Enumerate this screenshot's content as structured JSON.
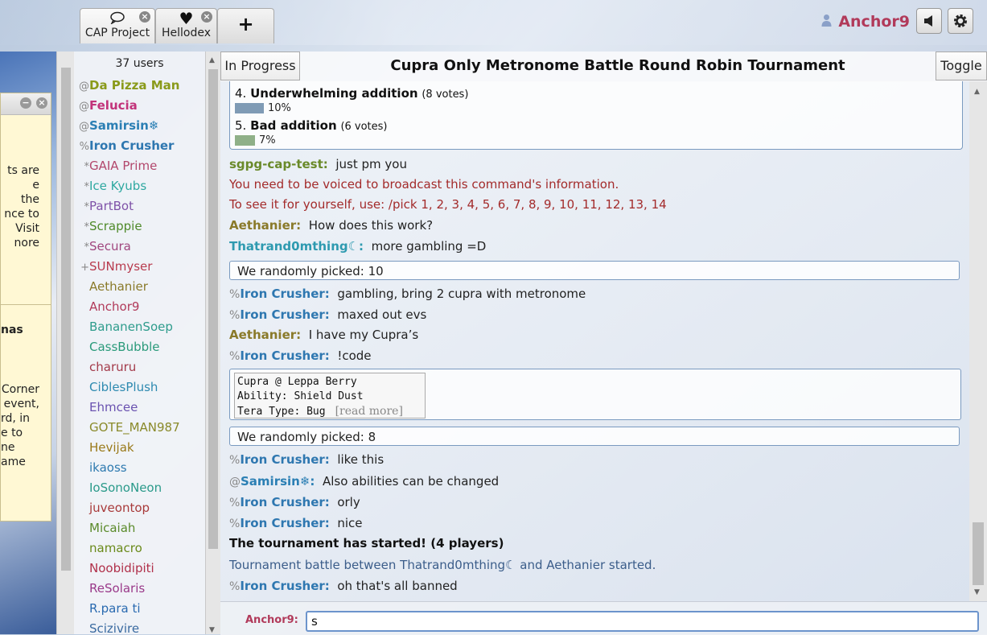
{
  "tabs": [
    {
      "label": "CAP Project",
      "icon": "💬"
    },
    {
      "label": "Hellodex",
      "icon": "♥"
    },
    {
      "label": "",
      "icon": "+"
    }
  ],
  "header_user": {
    "name": "Anchor9"
  },
  "popup": {
    "lines_top": [
      "ts are",
      "e",
      "the",
      "nce to",
      "Visit",
      "nore"
    ],
    "lines_bottom": [
      "nas",
      "",
      "Corner",
      "event,",
      "rd, in",
      "e to",
      "ne",
      "ame"
    ]
  },
  "userlist": {
    "count": "37 users",
    "users": [
      {
        "rank": "@",
        "name": "Da Pizza Man",
        "color": "#8a9a1a",
        "bold": true
      },
      {
        "rank": "@",
        "name": "Felucia",
        "color": "#c2337a",
        "bold": true
      },
      {
        "rank": "@",
        "name": "Samirsin❄",
        "color": "#2b7fb4",
        "bold": true
      },
      {
        "rank": "%",
        "name": "Iron Crusher",
        "color": "#2e77b0",
        "bold": true
      },
      {
        "rank": "*",
        "name": "GAIA Prime",
        "color": "#b2476c",
        "bold": false
      },
      {
        "rank": "*",
        "name": "Ice Kyubs",
        "color": "#2ea8a0",
        "bold": false
      },
      {
        "rank": "*",
        "name": "PartBot",
        "color": "#7f52a8",
        "bold": false
      },
      {
        "rank": "*",
        "name": "Scrappie",
        "color": "#4f8a2a",
        "bold": false
      },
      {
        "rank": "*",
        "name": "Secura",
        "color": "#a0467e",
        "bold": false
      },
      {
        "rank": "+",
        "name": "SUNmyser",
        "color": "#b83b4e",
        "bold": false
      },
      {
        "rank": "",
        "name": "Aethanier",
        "color": "#8a7a2a",
        "bold": false
      },
      {
        "rank": "",
        "name": "Anchor9",
        "color": "#b13a5a",
        "bold": false
      },
      {
        "rank": "",
        "name": "BananenSoep",
        "color": "#2e9c8c",
        "bold": false
      },
      {
        "rank": "",
        "name": "CassBubble",
        "color": "#2a9a7a",
        "bold": false
      },
      {
        "rank": "",
        "name": "charuru",
        "color": "#a33a4a",
        "bold": false
      },
      {
        "rank": "",
        "name": "CiblesPlush",
        "color": "#2e8ab0",
        "bold": false
      },
      {
        "rank": "",
        "name": "Ehmcee",
        "color": "#6a52b0",
        "bold": false
      },
      {
        "rank": "",
        "name": "GOTE_MAN987",
        "color": "#8a8a2a",
        "bold": false
      },
      {
        "rank": "",
        "name": "Hevijak",
        "color": "#9a7a1a",
        "bold": false
      },
      {
        "rank": "",
        "name": "ikaoss",
        "color": "#2e7ab0",
        "bold": false
      },
      {
        "rank": "",
        "name": "IoSonoNeon",
        "color": "#2a9a8a",
        "bold": false
      },
      {
        "rank": "",
        "name": "juveontop",
        "color": "#a83a3a",
        "bold": false
      },
      {
        "rank": "",
        "name": "Micaiah",
        "color": "#5a8a2a",
        "bold": false
      },
      {
        "rank": "",
        "name": "namacro",
        "color": "#6a8a1a",
        "bold": false
      },
      {
        "rank": "",
        "name": "Noobidipiti",
        "color": "#b0304a",
        "bold": false
      },
      {
        "rank": "",
        "name": "ReSolaris",
        "color": "#9a3a8a",
        "bold": false
      },
      {
        "rank": "",
        "name": "R.para ti",
        "color": "#2a6ab0",
        "bold": false
      },
      {
        "rank": "",
        "name": "Scizivire",
        "color": "#3a6aa0",
        "bold": false
      }
    ]
  },
  "chat_header": {
    "status": "In Progress",
    "title": "Cupra Only Metronome Battle Round Robin Tournament",
    "toggle": "Toggle"
  },
  "poll": {
    "options": [
      {
        "num": "4.",
        "label": "Underwhelming addition",
        "votes": "(8 votes)",
        "pct": "10%",
        "fraction": 0.1,
        "color": "#7f9bb5"
      },
      {
        "num": "5.",
        "label": "Bad addition",
        "votes": "(6 votes)",
        "pct": "7%",
        "fraction": 0.07,
        "color": "#8fb088"
      }
    ]
  },
  "messages": [
    {
      "rank": "",
      "nick": "sgpg-cap-test:",
      "nick_color": "#6a8a2a",
      "text": "just pm you"
    },
    {
      "type": "error",
      "text": "You need to be voiced to broadcast this command's information."
    },
    {
      "type": "error",
      "text": "To see it for yourself, use: /pick 1, 2, 3, 4, 5, 6, 7, 8, 9, 10, 11, 12, 13, 14"
    },
    {
      "rank": "",
      "nick": "Aethanier:",
      "nick_color": "#8a7a2a",
      "text": "How does this work?"
    },
    {
      "rank": "",
      "nick": "Thatrand0mthing☾:",
      "nick_color": "#2e9ab0",
      "text": "more gambling =D"
    },
    {
      "type": "picked",
      "text": "We randomly picked:  10"
    },
    {
      "rank": "%",
      "nick": "Iron Crusher:",
      "nick_color": "#2e77b0",
      "text": "gambling, bring 2 cupra with metronome"
    },
    {
      "rank": "%",
      "nick": "Iron Crusher:",
      "nick_color": "#2e77b0",
      "text": "maxed out evs"
    },
    {
      "rank": "",
      "nick": "Aethanier:",
      "nick_color": "#8a7a2a",
      "text": "I have my Cupra’s"
    },
    {
      "rank": "%",
      "nick": "Iron Crusher:",
      "nick_color": "#2e77b0",
      "text": "!code"
    },
    {
      "type": "picked",
      "text": "We randomly picked:  8"
    },
    {
      "rank": "%",
      "nick": "Iron Crusher:",
      "nick_color": "#2e77b0",
      "text": "like this"
    },
    {
      "rank": "@",
      "nick": "Samirsin❄:",
      "nick_color": "#2b7fb4",
      "text": "Also abilities can be changed"
    },
    {
      "rank": "%",
      "nick": "Iron Crusher:",
      "nick_color": "#2e77b0",
      "text": "orly"
    },
    {
      "rank": "%",
      "nick": "Iron Crusher:",
      "nick_color": "#2e77b0",
      "text": "nice"
    },
    {
      "type": "bold",
      "text": "The tournament has started! (4 players)"
    },
    {
      "type": "info",
      "text": "Tournament battle between Thatrand0mthing☾ and Aethanier started."
    },
    {
      "rank": "%",
      "nick": "Iron Crusher:",
      "nick_color": "#2e77b0",
      "text": "oh that's all banned"
    }
  ],
  "code": {
    "lines": [
      "Cupra @ Leppa Berry",
      "Ability: Shield Dust",
      "Tera Type: Bug"
    ],
    "read_more": "[read more]"
  },
  "input": {
    "nick": "Anchor9:",
    "value": "s"
  }
}
